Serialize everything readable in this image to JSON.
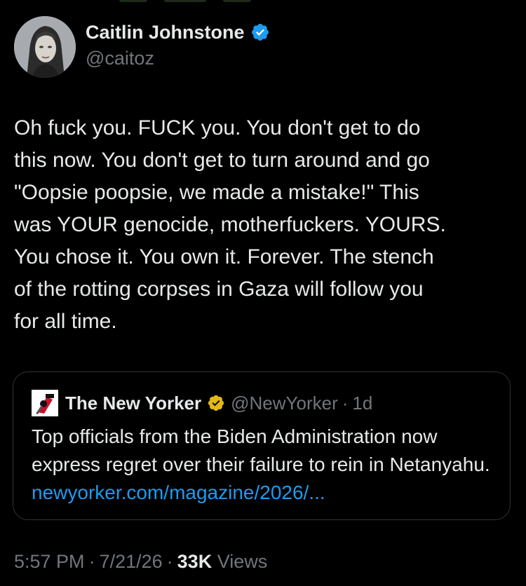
{
  "author": {
    "display_name": "Caitlin Johnstone",
    "handle": "@caitoz",
    "verified": true,
    "verified_color": "#1d9bf0"
  },
  "tweet": {
    "text": "Oh fuck you. FUCK you. You don't get to do\nthis now. You don't get to turn around and go\n\"Oopsie poopsie, we made a mistake!\" This\nwas YOUR genocide, motherfuckers. YOURS.\nYou chose it. You own it. Forever. The stench\nof the rotting corpses in Gaza will follow you\nfor all time."
  },
  "quote": {
    "display_name": "The New Yorker",
    "handle": "@NewYorker",
    "separator": "·",
    "time": "1d",
    "verified_badge": "gold",
    "verified_color": "#e2b719",
    "text": "Top officials from the Biden Administration now express regret over their failure to rein in Netanyahu.",
    "link_text": "newyorker.com/magazine/2026/...",
    "link_color": "#1d9bf0"
  },
  "meta": {
    "time": "5:57 PM",
    "separator": "·",
    "date": "7/21/26",
    "views_count": "33K",
    "views_label": "Views"
  },
  "icons": {
    "author_verified": "verified-check-icon",
    "quote_verified": "gold-verified-check-icon",
    "quote_avatar": "new-yorker-logo-icon"
  },
  "theme": {
    "background": "#000000",
    "text_primary": "#e7e9ea",
    "text_secondary": "#71767b",
    "border": "#2f3336"
  }
}
